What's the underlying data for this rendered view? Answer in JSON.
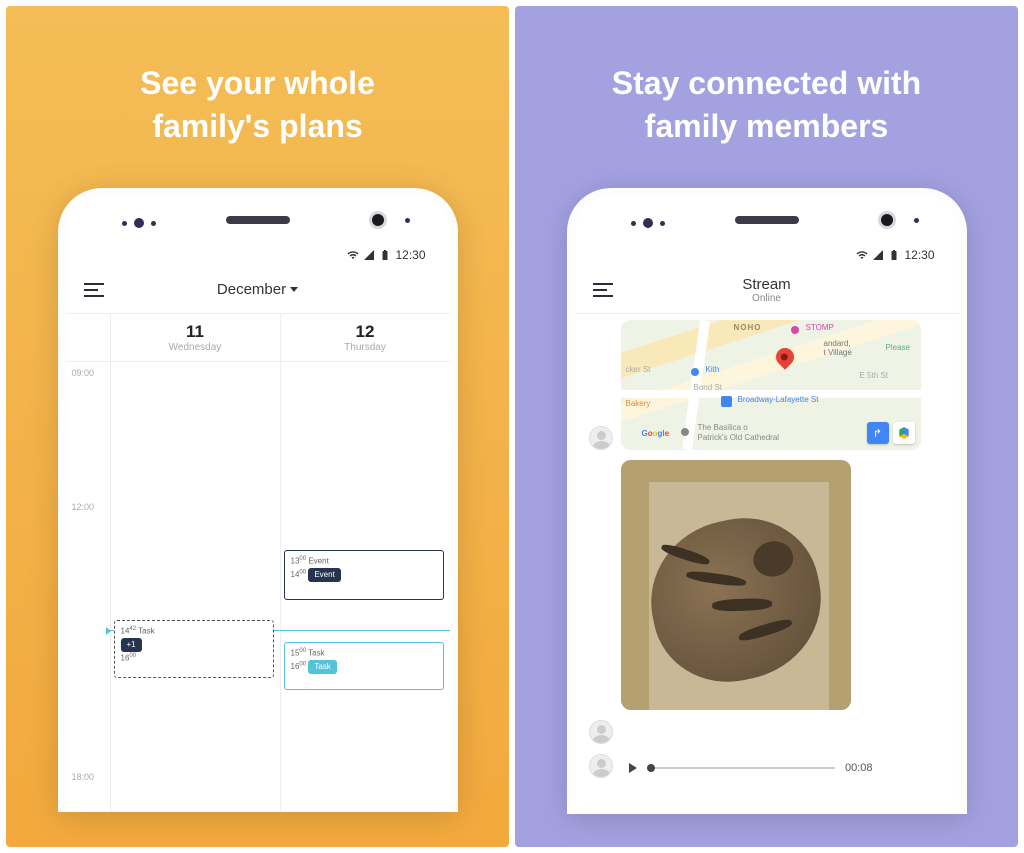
{
  "panels": {
    "left": {
      "headline_l1": "See your whole",
      "headline_l2": "family's plans",
      "status_time": "12:30",
      "header_title": "December",
      "columns": [
        {
          "num": "11",
          "day": "Wednesday"
        },
        {
          "num": "12",
          "day": "Thursday"
        }
      ],
      "hours": {
        "h9": "09:00",
        "h12": "12:00",
        "h18": "18:00"
      },
      "events": {
        "ev1": {
          "start": "13",
          "start_min": "00",
          "end": "14",
          "end_min": "00",
          "title": "Event",
          "pill": "Event"
        },
        "ev2": {
          "start": "14",
          "start_min": "42",
          "end": "16",
          "end_min": "00",
          "title": "Task",
          "pill": "+1"
        },
        "ev3": {
          "start": "15",
          "start_min": "00",
          "end": "16",
          "end_min": "00",
          "title": "Task",
          "pill": "Task"
        }
      }
    },
    "right": {
      "headline_l1": "Stay connected with",
      "headline_l2": "family members",
      "status_time": "12:30",
      "header_title": "Stream",
      "header_sub": "Online",
      "map": {
        "noho": "NOHO",
        "stomp": "STOMP",
        "village": "t Village",
        "standard": "andard,",
        "kith": "Kith",
        "bakery": "Bakery",
        "bond": "Bond St",
        "broadway": "Broadway-Lafayette St",
        "e5th": "E 5th St",
        "please": "Please",
        "google": "Google",
        "basilica_l1": "The Basilica o",
        "basilica_l2": "Patrick's Old Cathedral",
        "cker": "cker St"
      },
      "audio_time": "00:08"
    }
  }
}
